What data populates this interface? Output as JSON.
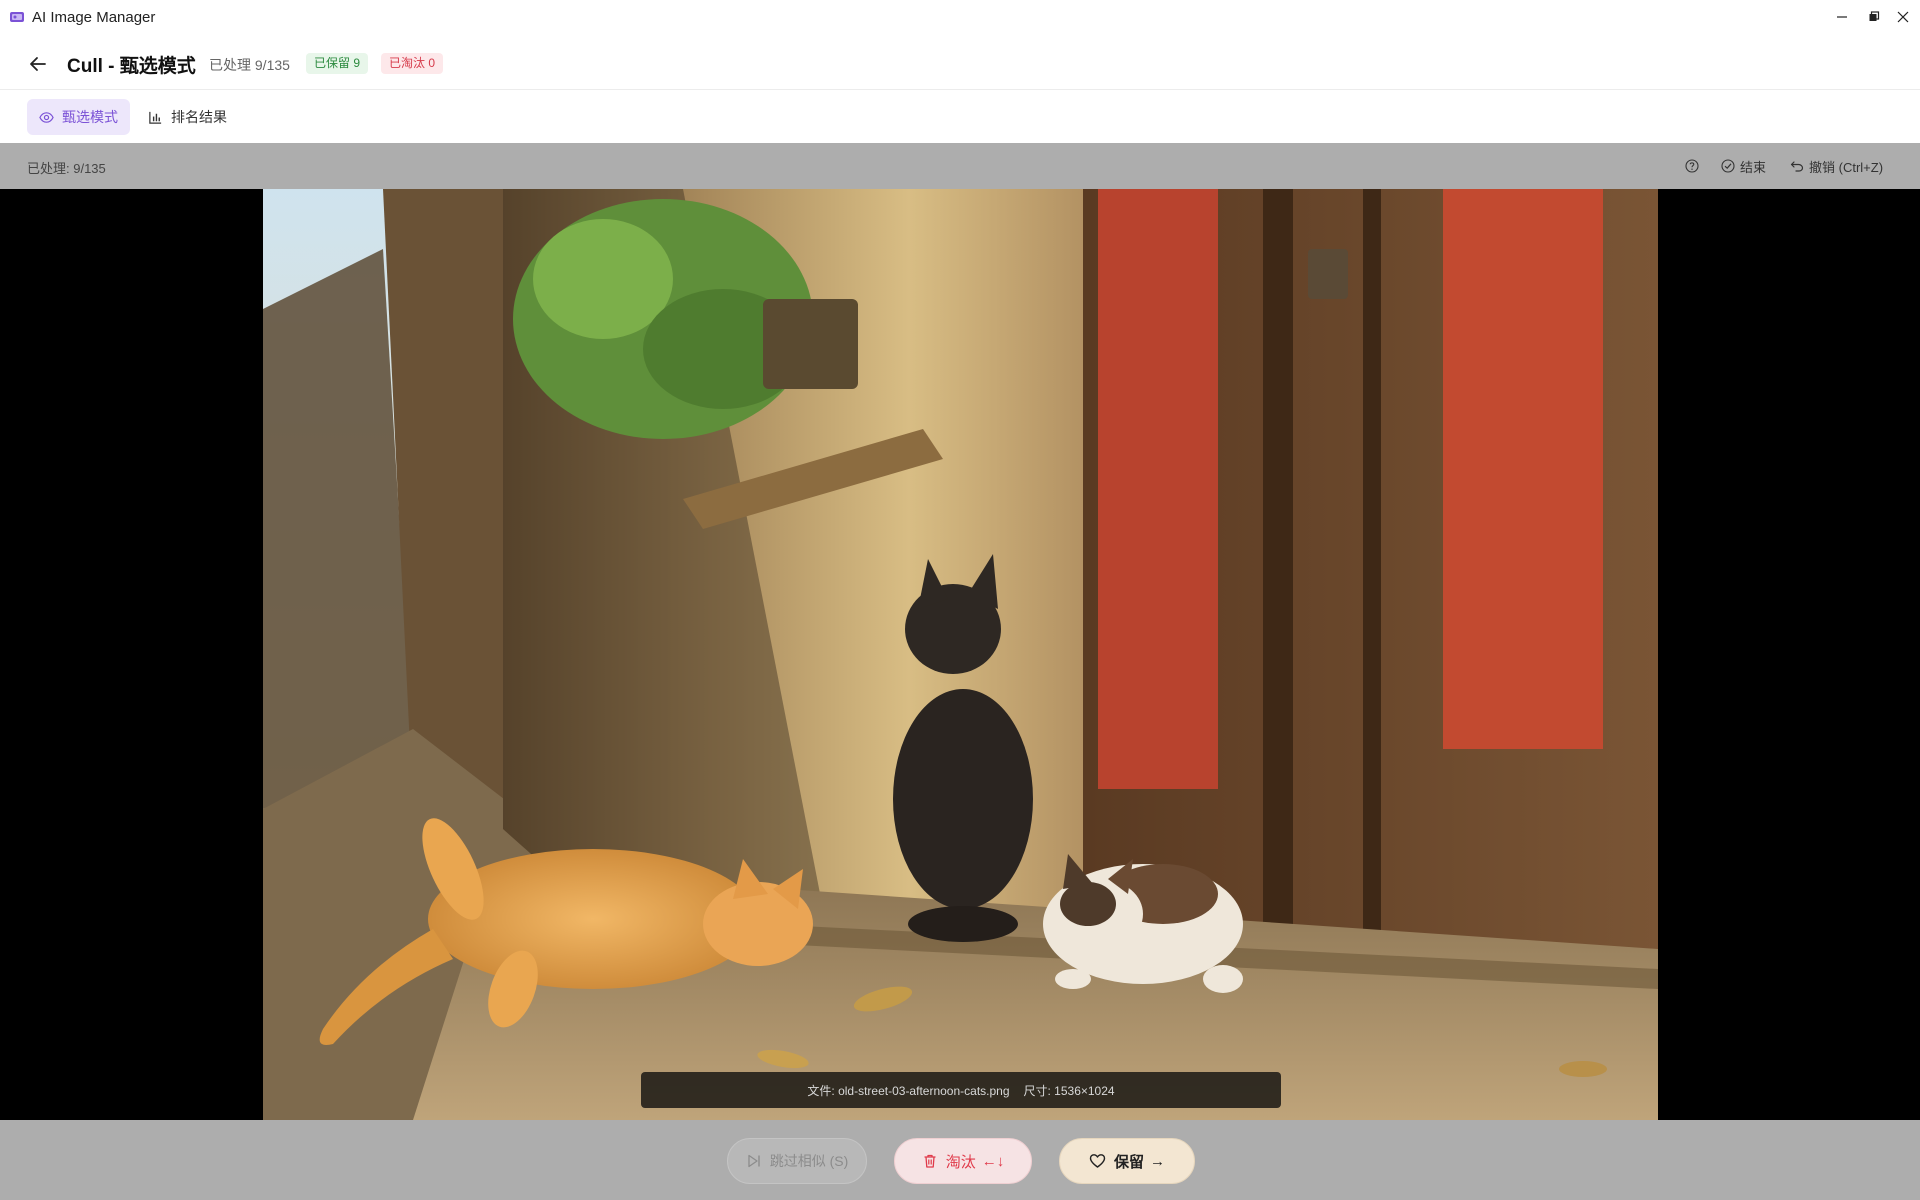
{
  "window": {
    "title": "AI Image Manager",
    "icons": [
      "app-logo-icon",
      "minimize-icon",
      "maximize-icon",
      "close-icon"
    ]
  },
  "header": {
    "title": "Cull - 甄选模式",
    "processed": "已处理 9/135",
    "kept_badge": "已保留 9",
    "rejected_badge": "已淘汰 0",
    "colors": {
      "kept": "#2b8a3e",
      "rejected": "#d63a4a"
    }
  },
  "tabs": [
    {
      "label": "甄选模式",
      "icon": "eye-icon",
      "active": true
    },
    {
      "label": "排名结果",
      "icon": "bar-chart-icon",
      "active": false
    }
  ],
  "toolbar": {
    "status": "已处理: 9/135",
    "finish_label": "结束",
    "undo_label": "撤销 (Ctrl+Z)"
  },
  "viewer": {
    "file_label": "文件: old-street-03-afternoon-cats.png",
    "size_label": "尺寸: 1536×1024"
  },
  "actions": {
    "skip_label": "跳过相似 (S)",
    "reject_label": "淘汰",
    "reject_keys": "←↓",
    "keep_label": "保留",
    "keep_keys": "→"
  },
  "colors": {
    "accent": "#7b52d6",
    "reject": "#e03a4a",
    "toolbar_bg": "#adadad"
  }
}
